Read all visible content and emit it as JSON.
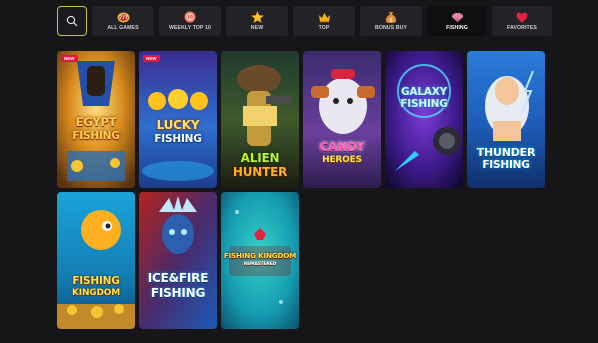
{
  "tabs": [
    {
      "label": "ALL GAMES",
      "icon": "all-games-icon"
    },
    {
      "label": "WEEKLY TOP 10",
      "icon": "top10-icon"
    },
    {
      "label": "NEW",
      "icon": "star-icon"
    },
    {
      "label": "TOP",
      "icon": "crown-icon"
    },
    {
      "label": "BONUS BUY",
      "icon": "money-bag-icon"
    },
    {
      "label": "FISHING",
      "icon": "shell-icon",
      "active": true
    },
    {
      "label": "FAVORITES",
      "icon": "heart-icon"
    }
  ],
  "games": [
    {
      "title1": "EGYPT",
      "title2": "FISHING",
      "badge": "NEW"
    },
    {
      "title1": "LUCKY",
      "title2": "FISHING",
      "badge": "NEW"
    },
    {
      "title1": "ALIEN",
      "title2": "HUNTER"
    },
    {
      "title1": "CANDY",
      "title2": "HEROES"
    },
    {
      "title1": "GALAXY",
      "title2": "FISHING"
    },
    {
      "title1": "THUNDER",
      "title2": "FISHING"
    },
    {
      "title1": "FISHING",
      "title2": "KINGDOM"
    },
    {
      "title1": "ICE&FIRE",
      "title2": "FISHING"
    },
    {
      "title1": "FISHING KINGDOM",
      "title2": "REMASTERED"
    }
  ],
  "colors": {
    "accent": "#c9c436",
    "background": "#161619",
    "tab": "#222227",
    "badge": "#e0143c"
  }
}
